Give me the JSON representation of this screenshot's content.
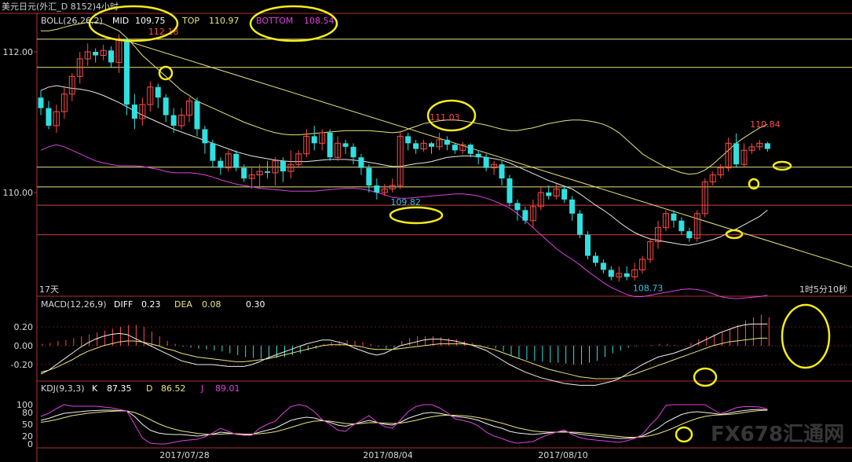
{
  "window": {
    "title": "美元日元(外汇_D 8152)4小时"
  },
  "indicators": {
    "boll": {
      "label": "BOLL(26,26,2)",
      "mid_label": "MID",
      "mid": "109.75",
      "top_label": "TOP",
      "top": "110.97",
      "bottom_label": "BOTTOM",
      "bottom": "108.54"
    },
    "macd": {
      "label": "MACD(12,26,9)",
      "diff_label": "DIFF",
      "diff": "0.23",
      "dea_label": "DEA",
      "dea": "0.08",
      "macd": "0.30"
    },
    "kdj": {
      "label": "KDJ(9,3,3)",
      "k_label": "K",
      "k": "87.35",
      "d_label": "D",
      "d": "86.52",
      "j_label": "J",
      "j": "89.01"
    }
  },
  "info": {
    "period": "17天",
    "timer": "1时5分10秒"
  },
  "watermark": "FX678汇通网",
  "colors": {
    "up": "#ff4a4a",
    "down": "#30e0e0",
    "mid": "#e8e8e8",
    "top": "#e8e47c",
    "bottom": "#e040e0",
    "hline": "#e8e47c",
    "redline": "#d04040",
    "axis": "#b03030"
  },
  "chart_data": {
    "type": "candlestick",
    "instrument": "美元日元",
    "timeframe": "4小时",
    "y_ticks": [
      112.0,
      110.0
    ],
    "y_tick_labels": [
      "112.00",
      "110.00"
    ],
    "x_tick_labels": [
      "2017/07/28",
      "2017/08/04",
      "2017/08/10"
    ],
    "annotations": [
      {
        "text": "112.18",
        "value": 112.18
      },
      {
        "text": "111.03",
        "value": 111.03
      },
      {
        "text": "109.82",
        "value": 109.82
      },
      {
        "text": "108.73",
        "value": 108.73
      },
      {
        "text": "110.84",
        "value": 110.84
      }
    ],
    "horizontal_lines": [
      112.18,
      111.78,
      110.36,
      110.08
    ],
    "red_horizontal_lines": [
      109.82,
      109.4
    ],
    "candles": [
      [
        111.35,
        111.2,
        111.45,
        111.1
      ],
      [
        111.2,
        110.95,
        111.3,
        110.9
      ],
      [
        110.95,
        111.15,
        111.25,
        110.85
      ],
      [
        111.15,
        111.4,
        111.5,
        111.05
      ],
      [
        111.4,
        111.65,
        111.7,
        111.3
      ],
      [
        111.65,
        111.9,
        112.0,
        111.55
      ],
      [
        111.9,
        112.0,
        112.12,
        111.8
      ],
      [
        112.0,
        111.95,
        112.05,
        111.85
      ],
      [
        111.95,
        112.02,
        112.1,
        111.88
      ],
      [
        112.02,
        111.85,
        112.08,
        111.78
      ],
      [
        111.85,
        112.18,
        112.25,
        111.7
      ],
      [
        112.18,
        111.25,
        112.2,
        111.1
      ],
      [
        111.25,
        111.05,
        111.4,
        110.9
      ],
      [
        111.05,
        111.25,
        111.35,
        110.95
      ],
      [
        111.25,
        111.5,
        111.58,
        111.15
      ],
      [
        111.5,
        111.35,
        111.55,
        111.2
      ],
      [
        111.35,
        111.1,
        111.4,
        111.0
      ],
      [
        111.1,
        110.95,
        111.2,
        110.85
      ],
      [
        110.95,
        111.1,
        111.2,
        110.9
      ],
      [
        111.1,
        111.3,
        111.36,
        111.0
      ],
      [
        111.3,
        110.9,
        111.35,
        110.8
      ],
      [
        110.9,
        110.7,
        110.95,
        110.55
      ],
      [
        110.7,
        110.45,
        110.75,
        110.35
      ],
      [
        110.45,
        110.35,
        110.5,
        110.25
      ],
      [
        110.35,
        110.55,
        110.6,
        110.3
      ],
      [
        110.55,
        110.35,
        110.6,
        110.3
      ],
      [
        110.35,
        110.2,
        110.4,
        110.15
      ],
      [
        110.2,
        110.25,
        110.35,
        110.05
      ],
      [
        110.25,
        110.3,
        110.4,
        110.05
      ],
      [
        110.3,
        110.28,
        110.45,
        110.2
      ],
      [
        110.28,
        110.45,
        110.5,
        110.1
      ],
      [
        110.45,
        110.3,
        110.5,
        110.15
      ],
      [
        110.3,
        110.4,
        110.6,
        110.2
      ],
      [
        110.4,
        110.55,
        110.6,
        110.35
      ],
      [
        110.55,
        110.8,
        110.9,
        110.5
      ],
      [
        110.8,
        110.7,
        110.95,
        110.6
      ],
      [
        110.7,
        110.85,
        110.9,
        110.6
      ],
      [
        110.85,
        110.5,
        110.9,
        110.45
      ],
      [
        110.5,
        110.7,
        110.8,
        110.45
      ],
      [
        110.7,
        110.65,
        110.75,
        110.55
      ],
      [
        110.65,
        110.5,
        110.7,
        110.4
      ],
      [
        110.5,
        110.35,
        110.55,
        110.25
      ],
      [
        110.35,
        110.1,
        110.4,
        110.0
      ],
      [
        110.1,
        110.0,
        110.2,
        109.9
      ],
      [
        110.0,
        110.05,
        110.12,
        109.95
      ],
      [
        110.05,
        110.1,
        110.2,
        110.0
      ],
      [
        110.1,
        110.8,
        110.88,
        110.05
      ],
      [
        110.8,
        110.7,
        110.85,
        110.6
      ],
      [
        110.7,
        110.62,
        110.75,
        110.55
      ],
      [
        110.62,
        110.7,
        110.75,
        110.58
      ],
      [
        110.7,
        110.65,
        110.72,
        110.55
      ],
      [
        110.65,
        110.75,
        110.85,
        110.6
      ],
      [
        110.75,
        110.68,
        110.8,
        110.6
      ],
      [
        110.68,
        110.6,
        110.7,
        110.55
      ],
      [
        110.6,
        110.68,
        110.72,
        110.55
      ],
      [
        110.68,
        110.55,
        110.7,
        110.5
      ],
      [
        110.55,
        110.5,
        110.6,
        110.4
      ],
      [
        110.5,
        110.35,
        110.55,
        110.3
      ],
      [
        110.35,
        110.4,
        110.45,
        110.25
      ],
      [
        110.4,
        110.2,
        110.45,
        110.1
      ],
      [
        110.2,
        109.85,
        110.25,
        109.8
      ],
      [
        109.85,
        109.75,
        109.9,
        109.6
      ],
      [
        109.75,
        109.6,
        109.8,
        109.55
      ],
      [
        109.6,
        109.8,
        109.9,
        109.5
      ],
      [
        109.8,
        110.0,
        110.08,
        109.75
      ],
      [
        110.0,
        109.95,
        110.1,
        109.9
      ],
      [
        109.95,
        110.05,
        110.12,
        109.9
      ],
      [
        110.05,
        109.9,
        110.1,
        109.85
      ],
      [
        109.9,
        109.7,
        109.95,
        109.6
      ],
      [
        109.7,
        109.4,
        109.75,
        109.35
      ],
      [
        109.4,
        109.1,
        109.45,
        109.05
      ],
      [
        109.1,
        109.0,
        109.15,
        108.95
      ],
      [
        109.0,
        108.9,
        109.05,
        108.85
      ],
      [
        108.9,
        108.8,
        108.95,
        108.75
      ],
      [
        108.8,
        108.85,
        108.95,
        108.73
      ],
      [
        108.85,
        108.8,
        108.95,
        108.75
      ],
      [
        108.8,
        108.9,
        109.0,
        108.75
      ],
      [
        108.9,
        109.05,
        109.1,
        108.85
      ],
      [
        109.05,
        109.3,
        109.35,
        109.0
      ],
      [
        109.3,
        109.5,
        109.6,
        109.2
      ],
      [
        109.5,
        109.7,
        109.75,
        109.45
      ],
      [
        109.7,
        109.6,
        109.75,
        109.5
      ],
      [
        109.6,
        109.45,
        109.65,
        109.4
      ],
      [
        109.45,
        109.35,
        109.5,
        109.3
      ],
      [
        109.35,
        109.7,
        109.75,
        109.3
      ],
      [
        109.7,
        110.15,
        110.2,
        109.65
      ],
      [
        110.15,
        110.25,
        110.3,
        110.1
      ],
      [
        110.25,
        110.35,
        110.4,
        110.2
      ],
      [
        110.35,
        110.7,
        110.78,
        110.3
      ],
      [
        110.7,
        110.4,
        110.84,
        110.35
      ],
      [
        110.4,
        110.6,
        110.7,
        110.35
      ],
      [
        110.6,
        110.65,
        110.7,
        110.55
      ],
      [
        110.65,
        110.7,
        110.75,
        110.6
      ],
      [
        110.7,
        110.62,
        110.72,
        110.58
      ]
    ],
    "mid_band": [
      111.45,
      111.5,
      111.52,
      111.5,
      111.48,
      111.47,
      111.45,
      111.42,
      111.38,
      111.33,
      111.28,
      111.22,
      111.16,
      111.1,
      111.05,
      111.0,
      110.95,
      110.9,
      110.86,
      110.82,
      110.78,
      110.74,
      110.7,
      110.66,
      110.62,
      110.58,
      110.55,
      110.52,
      110.5,
      110.48,
      110.46,
      110.45,
      110.44,
      110.44,
      110.44,
      110.45,
      110.46,
      110.47,
      110.47,
      110.47,
      110.46,
      110.45,
      110.43,
      110.41,
      110.39,
      110.37,
      110.37,
      110.39,
      110.41,
      110.42,
      110.44,
      110.47,
      110.5,
      110.51,
      110.52,
      110.52,
      110.51,
      110.5,
      110.48,
      110.46,
      110.42,
      110.37,
      110.32,
      110.27,
      110.22,
      110.17,
      110.13,
      110.09,
      110.05,
      109.98,
      109.9,
      109.82,
      109.75,
      109.67,
      109.58,
      109.5,
      109.43,
      109.38,
      109.34,
      109.32,
      109.3,
      109.28,
      109.26,
      109.25,
      109.27,
      109.3,
      109.33,
      109.37,
      109.43,
      109.48,
      109.54,
      109.6,
      109.66,
      109.75
    ],
    "top_band": [
      112.3,
      112.3,
      112.32,
      112.35,
      112.38,
      112.4,
      112.42,
      112.42,
      112.4,
      112.35,
      112.3,
      112.2,
      112.08,
      111.95,
      111.85,
      111.75,
      111.65,
      111.55,
      111.45,
      111.38,
      111.3,
      111.25,
      111.2,
      111.15,
      111.1,
      111.05,
      111.0,
      110.96,
      110.92,
      110.88,
      110.85,
      110.83,
      110.82,
      110.82,
      110.83,
      110.84,
      110.85,
      110.86,
      110.87,
      110.88,
      110.88,
      110.88,
      110.88,
      110.87,
      110.86,
      110.85,
      110.86,
      110.9,
      110.94,
      110.98,
      111.0,
      111.02,
      111.03,
      111.03,
      111.02,
      111.0,
      110.98,
      110.96,
      110.93,
      110.9,
      110.88,
      110.88,
      110.9,
      110.92,
      110.95,
      110.98,
      111.0,
      111.02,
      111.03,
      111.03,
      111.02,
      111.0,
      110.97,
      110.92,
      110.85,
      110.75,
      110.65,
      110.55,
      110.48,
      110.42,
      110.36,
      110.32,
      110.28,
      110.26,
      110.27,
      110.32,
      110.4,
      110.5,
      110.6,
      110.7,
      110.78,
      110.85,
      110.92,
      110.97
    ],
    "bottom_band": [
      110.6,
      110.65,
      110.68,
      110.65,
      110.6,
      110.55,
      110.5,
      110.45,
      110.42,
      110.4,
      110.38,
      110.38,
      110.38,
      110.37,
      110.35,
      110.33,
      110.3,
      110.28,
      110.28,
      110.28,
      110.27,
      110.25,
      110.22,
      110.18,
      110.15,
      110.12,
      110.1,
      110.08,
      110.06,
      110.05,
      110.04,
      110.03,
      110.02,
      110.02,
      110.02,
      110.02,
      110.03,
      110.04,
      110.05,
      110.06,
      110.06,
      110.05,
      110.03,
      110.0,
      109.97,
      109.93,
      109.92,
      109.92,
      109.93,
      109.94,
      109.95,
      109.96,
      109.97,
      109.98,
      109.98,
      109.97,
      109.95,
      109.92,
      109.88,
      109.83,
      109.78,
      109.7,
      109.6,
      109.5,
      109.4,
      109.3,
      109.2,
      109.12,
      109.05,
      108.97,
      108.88,
      108.8,
      108.72,
      108.65,
      108.6,
      108.55,
      108.52,
      108.52,
      108.54,
      108.56,
      108.58,
      108.6,
      108.62,
      108.63,
      108.62,
      108.6,
      108.56,
      108.52,
      108.5,
      108.49,
      108.5,
      108.51,
      108.52,
      108.54
    ],
    "trendlines": [
      {
        "from": [
          112.3,
          0
        ],
        "to": [
          109.5,
          93
        ],
        "color": "#e8e47c"
      }
    ],
    "macd_y_ticks": [
      "0.20",
      "0.00",
      "-0.20"
    ],
    "macd_hist": [
      0.02,
      0.03,
      0.05,
      0.06,
      0.08,
      0.1,
      0.12,
      0.14,
      0.16,
      0.18,
      0.2,
      0.22,
      0.22,
      0.2,
      0.15,
      0.1,
      0.05,
      0.02,
      -0.01,
      -0.02,
      -0.03,
      -0.04,
      -0.05,
      -0.06,
      -0.08,
      -0.1,
      -0.12,
      -0.13,
      -0.14,
      -0.14,
      -0.13,
      -0.12,
      -0.1,
      -0.08,
      -0.05,
      -0.03,
      0.02,
      0.04,
      0.05,
      0.06,
      0.05,
      0.04,
      0.02,
      -0.01,
      -0.03,
      -0.02,
      0.05,
      0.08,
      0.1,
      0.1,
      0.1,
      0.09,
      0.08,
      0.07,
      0.05,
      0.03,
      0.01,
      -0.01,
      -0.03,
      -0.06,
      -0.1,
      -0.13,
      -0.15,
      -0.16,
      -0.17,
      -0.18,
      -0.18,
      -0.19,
      -0.2,
      -0.2,
      -0.18,
      -0.16,
      -0.12,
      -0.08,
      -0.05,
      -0.02,
      -0.01,
      0.0,
      0.01,
      0.02,
      0.02,
      0.01,
      0.0,
      0.03,
      0.07,
      0.1,
      0.12,
      0.15,
      0.18,
      0.22,
      0.27,
      0.3,
      0.33,
      0.3
    ],
    "macd_diff": [
      -0.3,
      -0.26,
      -0.2,
      -0.14,
      -0.08,
      -0.02,
      0.03,
      0.07,
      0.1,
      0.12,
      0.13,
      0.12,
      0.08,
      0.04,
      0.0,
      -0.04,
      -0.08,
      -0.12,
      -0.16,
      -0.18,
      -0.2,
      -0.2,
      -0.2,
      -0.21,
      -0.22,
      -0.22,
      -0.22,
      -0.2,
      -0.17,
      -0.13,
      -0.1,
      -0.07,
      -0.04,
      -0.01,
      0.02,
      0.04,
      0.06,
      0.06,
      0.04,
      0.02,
      -0.02,
      -0.05,
      -0.08,
      -0.1,
      -0.08,
      -0.04,
      0.0,
      0.02,
      0.04,
      0.06,
      0.07,
      0.07,
      0.06,
      0.05,
      0.03,
      0.01,
      -0.02,
      -0.05,
      -0.1,
      -0.15,
      -0.2,
      -0.24,
      -0.28,
      -0.31,
      -0.34,
      -0.36,
      -0.38,
      -0.4,
      -0.41,
      -0.42,
      -0.42,
      -0.42,
      -0.4,
      -0.38,
      -0.35,
      -0.3,
      -0.25,
      -0.2,
      -0.16,
      -0.12,
      -0.1,
      -0.08,
      -0.05,
      -0.02,
      0.02,
      0.06,
      0.1,
      0.14,
      0.17,
      0.2,
      0.22,
      0.23,
      0.23,
      0.23
    ],
    "macd_dea": [
      -0.28,
      -0.26,
      -0.23,
      -0.19,
      -0.15,
      -0.1,
      -0.06,
      -0.03,
      0.0,
      0.02,
      0.04,
      0.05,
      0.05,
      0.04,
      0.02,
      0.0,
      -0.03,
      -0.05,
      -0.08,
      -0.1,
      -0.12,
      -0.13,
      -0.14,
      -0.15,
      -0.16,
      -0.17,
      -0.17,
      -0.16,
      -0.15,
      -0.14,
      -0.12,
      -0.1,
      -0.08,
      -0.06,
      -0.04,
      -0.02,
      0.0,
      0.01,
      0.01,
      0.01,
      0.0,
      -0.01,
      -0.03,
      -0.04,
      -0.04,
      -0.04,
      -0.03,
      -0.02,
      -0.01,
      0.0,
      0.01,
      0.02,
      0.02,
      0.02,
      0.02,
      0.01,
      0.0,
      -0.02,
      -0.04,
      -0.07,
      -0.1,
      -0.13,
      -0.16,
      -0.19,
      -0.22,
      -0.25,
      -0.27,
      -0.29,
      -0.31,
      -0.33,
      -0.34,
      -0.35,
      -0.35,
      -0.35,
      -0.34,
      -0.32,
      -0.3,
      -0.27,
      -0.24,
      -0.21,
      -0.18,
      -0.15,
      -0.12,
      -0.09,
      -0.06,
      -0.03,
      0.0,
      0.02,
      0.04,
      0.05,
      0.06,
      0.07,
      0.08,
      0.08
    ],
    "kdj_y_ticks": [
      "100",
      "80",
      "50",
      "20",
      "0"
    ],
    "kdj_k": [
      60,
      65,
      72,
      78,
      80,
      82,
      84,
      85,
      86,
      86,
      85,
      84,
      70,
      50,
      35,
      28,
      25,
      24,
      24,
      22,
      20,
      22,
      25,
      30,
      28,
      25,
      24,
      24,
      30,
      35,
      40,
      50,
      60,
      65,
      68,
      66,
      60,
      55,
      48,
      45,
      50,
      55,
      60,
      55,
      50,
      48,
      55,
      65,
      72,
      78,
      80,
      78,
      74,
      70,
      68,
      65,
      60,
      52,
      45,
      40,
      32,
      28,
      26,
      24,
      26,
      28,
      30,
      32,
      28,
      25,
      22,
      20,
      18,
      16,
      14,
      14,
      16,
      20,
      30,
      40,
      55,
      65,
      75,
      80,
      82,
      80,
      78,
      75,
      78,
      82,
      85,
      87,
      88,
      87
    ],
    "kdj_d": [
      55,
      58,
      62,
      67,
      72,
      75,
      78,
      80,
      82,
      83,
      84,
      84,
      80,
      72,
      62,
      52,
      44,
      38,
      33,
      30,
      27,
      25,
      24,
      25,
      26,
      26,
      25,
      25,
      26,
      28,
      31,
      36,
      42,
      48,
      54,
      58,
      59,
      58,
      55,
      52,
      51,
      52,
      54,
      54,
      53,
      52,
      53,
      56,
      60,
      65,
      69,
      72,
      73,
      73,
      72,
      70,
      67,
      63,
      58,
      53,
      47,
      41,
      37,
      33,
      31,
      30,
      30,
      30,
      30,
      29,
      27,
      25,
      23,
      21,
      19,
      17,
      17,
      18,
      21,
      26,
      33,
      41,
      50,
      58,
      65,
      70,
      73,
      74,
      75,
      77,
      80,
      83,
      85,
      86
    ],
    "kdj_j": [
      70,
      78,
      90,
      100,
      96,
      96,
      96,
      96,
      94,
      92,
      88,
      84,
      50,
      15,
      2,
      0,
      0,
      4,
      8,
      10,
      12,
      18,
      28,
      40,
      32,
      24,
      22,
      22,
      40,
      50,
      58,
      78,
      95,
      100,
      96,
      82,
      62,
      50,
      35,
      32,
      48,
      60,
      72,
      56,
      44,
      40,
      60,
      82,
      95,
      100,
      100,
      92,
      80,
      64,
      60,
      55,
      46,
      30,
      20,
      14,
      6,
      2,
      4,
      6,
      16,
      24,
      30,
      36,
      24,
      16,
      12,
      10,
      8,
      6,
      4,
      8,
      14,
      24,
      48,
      68,
      98,
      100,
      100,
      100,
      100,
      100,
      88,
      77,
      84,
      92,
      95,
      95,
      94,
      89
    ],
    "x_tick_index": [
      34,
      100,
      160
    ]
  }
}
